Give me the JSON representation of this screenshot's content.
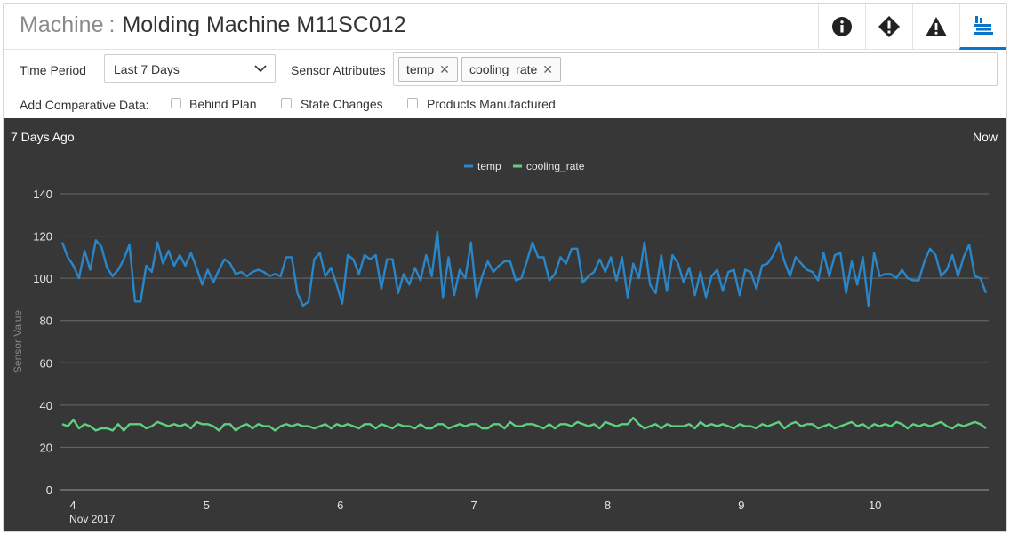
{
  "header": {
    "title_prefix": "Machine",
    "title_sep": ":",
    "title": "Molding Machine M11SC012",
    "buttons": [
      {
        "icon": "info-icon"
      },
      {
        "icon": "diamond-warning-icon"
      },
      {
        "icon": "warning-triangle-icon"
      },
      {
        "icon": "machine-icon"
      }
    ]
  },
  "controls": {
    "time_period_label": "Time Period",
    "time_period_value": "Last 7 Days",
    "sensor_attributes_label": "Sensor Attributes",
    "tags": [
      "temp",
      "cooling_rate"
    ],
    "tag_remove": "✕",
    "comparative_label": "Add Comparative Data:",
    "checkboxes": [
      {
        "label": "Behind Plan",
        "checked": false
      },
      {
        "label": "State Changes",
        "checked": false
      },
      {
        "label": "Products Manufactured",
        "checked": false
      }
    ]
  },
  "chart_range": {
    "start": "7 Days Ago",
    "end": "Now"
  },
  "colors": {
    "temp": "#2a86c8",
    "cooling_rate": "#5fcf80",
    "chart_bg": "#373737",
    "accent": "#0a74c8"
  },
  "chart_data": {
    "type": "line",
    "ylabel": "Sensor Value",
    "xlabel": "",
    "ylim": [
      0,
      140
    ],
    "yticks": [
      0,
      20,
      40,
      60,
      80,
      100,
      120,
      140
    ],
    "xlim": [
      3.9,
      10.85
    ],
    "xticks": [
      {
        "value": 4,
        "label": "4",
        "sublabel": "Nov 2017"
      },
      {
        "value": 5,
        "label": "5"
      },
      {
        "value": 6,
        "label": "6"
      },
      {
        "value": 7,
        "label": "7"
      },
      {
        "value": 8,
        "label": "8"
      },
      {
        "value": 9,
        "label": "9"
      },
      {
        "value": 10,
        "label": "10"
      }
    ],
    "x_start": 3.92,
    "x_end": 10.83,
    "grid": true,
    "legend_position": "top-center",
    "series": [
      {
        "name": "temp",
        "values": [
          117,
          110,
          106,
          100,
          113,
          104,
          118,
          115,
          105,
          101,
          104,
          109,
          116,
          89,
          89,
          106,
          103,
          117,
          107,
          113,
          106,
          111,
          106,
          112,
          105,
          97,
          104,
          98,
          104,
          109,
          107,
          102,
          103,
          101,
          103,
          104,
          103,
          101,
          102,
          101,
          110,
          110,
          93,
          87,
          89,
          109,
          112,
          101,
          105,
          97,
          88,
          111,
          109,
          102,
          111,
          109,
          111,
          95,
          109,
          109,
          93,
          102,
          97,
          105,
          99,
          111,
          101,
          122,
          91,
          110,
          92,
          104,
          100,
          117,
          91,
          101,
          108,
          103,
          106,
          108,
          108,
          99,
          100,
          108,
          117,
          110,
          110,
          99,
          102,
          110,
          107,
          114,
          114,
          98,
          101,
          103,
          109,
          103,
          110,
          99,
          110,
          91,
          107,
          100,
          117,
          97,
          93,
          111,
          94,
          111,
          107,
          98,
          105,
          92,
          103,
          91,
          101,
          104,
          94,
          103,
          104,
          92,
          104,
          103,
          95,
          106,
          107,
          111,
          117,
          108,
          101,
          110,
          107,
          104,
          103,
          99,
          112,
          101,
          111,
          112,
          93,
          108,
          97,
          110,
          87,
          112,
          101,
          102,
          102,
          100,
          104,
          100,
          99,
          99,
          108,
          114,
          111,
          101,
          104,
          111,
          101,
          110,
          116,
          101,
          100,
          93
        ],
        "color": "#2a86c8"
      },
      {
        "name": "cooling_rate",
        "values": [
          31,
          30,
          33,
          29,
          31,
          30,
          28,
          29,
          29,
          28,
          31,
          28,
          31,
          31,
          31,
          29,
          30,
          32,
          31,
          30,
          31,
          30,
          31,
          29,
          32,
          31,
          31,
          30,
          28,
          31,
          31,
          28,
          30,
          31,
          29,
          31,
          30,
          30,
          28,
          30,
          31,
          30,
          31,
          30,
          30,
          29,
          30,
          31,
          29,
          31,
          30,
          31,
          30,
          29,
          31,
          31,
          29,
          31,
          30,
          29,
          31,
          30,
          30,
          29,
          31,
          29,
          29,
          31,
          31,
          29,
          30,
          31,
          30,
          31,
          31,
          29,
          29,
          31,
          31,
          29,
          32,
          30,
          30,
          31,
          31,
          30,
          29,
          31,
          29,
          31,
          31,
          30,
          32,
          31,
          30,
          31,
          29,
          32,
          31,
          30,
          31,
          31,
          34,
          31,
          29,
          30,
          31,
          29,
          31,
          30,
          30,
          30,
          31,
          29,
          32,
          30,
          31,
          30,
          31,
          30,
          29,
          31,
          30,
          30,
          29,
          31,
          30,
          31,
          32,
          29,
          31,
          32,
          30,
          31,
          31,
          29,
          30,
          31,
          29,
          30,
          31,
          32,
          30,
          31,
          29,
          31,
          30,
          31,
          30,
          32,
          31,
          29,
          31,
          30,
          31,
          30,
          31,
          32,
          30,
          29,
          31,
          30,
          31,
          32,
          31,
          29
        ],
        "color": "#5fcf80"
      }
    ]
  }
}
